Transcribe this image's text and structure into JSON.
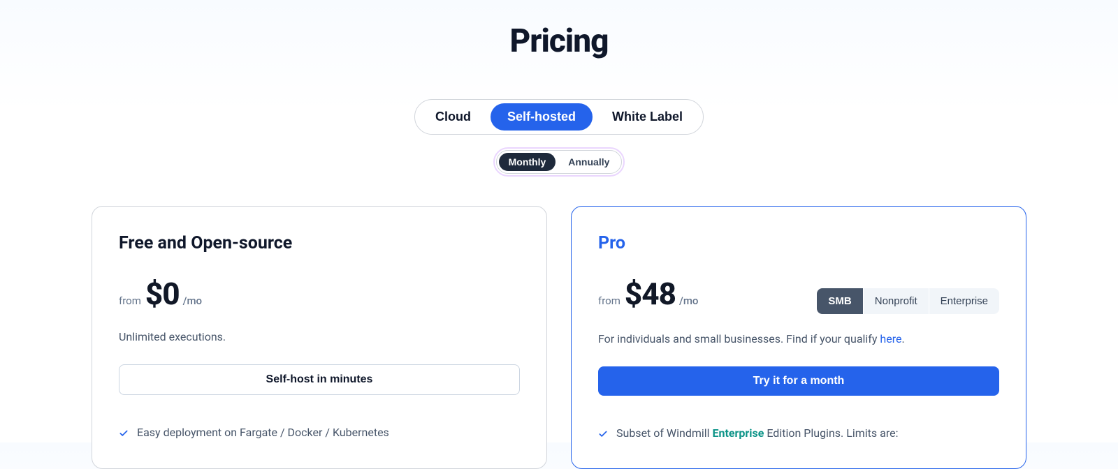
{
  "title": "Pricing",
  "deploymentTabs": {
    "cloud": "Cloud",
    "selfHosted": "Self-hosted",
    "whiteLabel": "White Label",
    "active": "selfHosted"
  },
  "periodTabs": {
    "monthly": "Monthly",
    "annually": "Annually",
    "active": "monthly"
  },
  "plans": {
    "free": {
      "name": "Free and Open-source",
      "priceFrom": "from",
      "priceAmount": "$0",
      "pricePeriod": "/mo",
      "description": "Unlimited executions.",
      "cta": "Self-host in minutes",
      "features": [
        "Easy deployment on Fargate / Docker / Kubernetes"
      ]
    },
    "pro": {
      "name": "Pro",
      "priceFrom": "from",
      "priceAmount": "$48",
      "pricePeriod": "/mo",
      "descriptionPrefix": "For individuals and small businesses. Find if your qualify ",
      "descriptionLink": "here",
      "descriptionSuffix": ".",
      "cta": "Try it for a month",
      "segments": {
        "smb": "SMB",
        "nonprofit": "Nonprofit",
        "enterprise": "Enterprise",
        "active": "smb"
      },
      "featurePrefix": "Subset of Windmill ",
      "featureHighlight": "Enterprise",
      "featureSuffix": " Edition Plugins. Limits are:"
    }
  }
}
